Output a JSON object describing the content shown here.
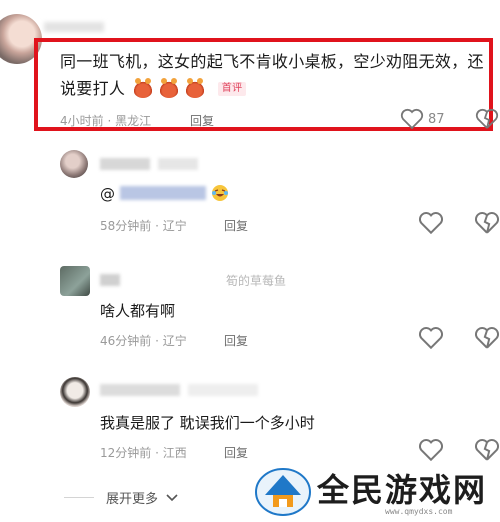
{
  "top_comment": {
    "text": "同一班飞机，这女的起飞不肯收小桌板，空少劝阻无效，还说要打人",
    "emojis": [
      "crab",
      "crab",
      "crab"
    ],
    "badge": "首评",
    "time": "4小时前",
    "location": "黑龙江",
    "reply_label": "回复",
    "likes": "87",
    "highlight_color": "#e0131c"
  },
  "replies": [
    {
      "text": "@",
      "emoji": "laugh-cry",
      "time": "58分钟前",
      "location": "辽宁",
      "reply_label": "回复"
    },
    {
      "author_fragment": "筍的草莓鱼",
      "text": "啥人都有啊",
      "time": "46分钟前",
      "location": "辽宁",
      "reply_label": "回复"
    },
    {
      "text": "我真是服了 耽误我们一个多小时",
      "time": "12分钟前",
      "location": "江西",
      "reply_label": "回复"
    }
  ],
  "footer": {
    "expand_label": "展开更多"
  },
  "watermark": {
    "title": "全民游戏网",
    "url": "www.qmydxs.com"
  },
  "colors": {
    "text": "#1a1a1a",
    "meta": "#9a9a9a",
    "highlight": "#e0131c"
  }
}
